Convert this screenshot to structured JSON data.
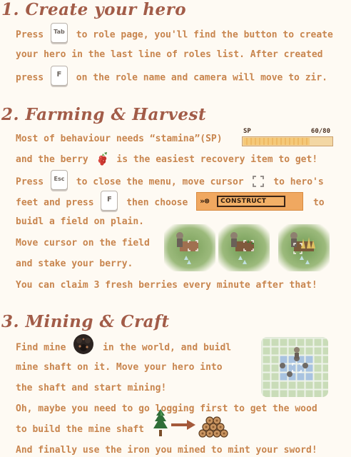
{
  "sections": [
    {
      "heading": "1. Create your hero",
      "lines": [
        {
          "a": "Press",
          "key": "Tab",
          "b": "to role page, you'll find the button to create"
        },
        {
          "a": "your hero in the last line of roles list.  After created"
        },
        {
          "a": "press",
          "key": "F",
          "b": "on the role name and camera will move to zir."
        }
      ]
    },
    {
      "heading": "2. Farming & Harvest",
      "lines": [
        {
          "a": "Most of behaviour needs “stamina”(SP)"
        },
        {
          "a": "and the berry",
          "b": "is the easiest recovery item to get!"
        },
        {
          "a": "Press",
          "key": "Esc",
          "b": "to close the menu, move cursor",
          "c": "to hero's"
        },
        {
          "a": "feet and press",
          "key": "F",
          "b": "then choose",
          "c": "to"
        },
        {
          "a": "buidl a field on plain."
        },
        {
          "a": "Move cursor on the field"
        },
        {
          "a": "and stake your berry."
        },
        {
          "a": "You can claim 3 fresh berries every minute after that!"
        }
      ]
    },
    {
      "heading": "3. Mining & Craft",
      "lines": [
        {
          "a": "Find mine",
          "b": "in the world, and buidl"
        },
        {
          "a": "mine shaft on it. Move your hero into"
        },
        {
          "a": "the shaft and start mining!"
        },
        {
          "a": "Oh, maybe you need to go logging first to get the wood"
        },
        {
          "a": "to build the mine shaft"
        },
        {
          "a": "And finally use the iron you mined to mint your sword!"
        }
      ]
    }
  ],
  "sp_bar": {
    "label": "SP",
    "value": "60/80",
    "fraction": 0.75
  },
  "construct_button": {
    "label": "CONSTRUCT"
  },
  "icons": {
    "berry": "berry-icon",
    "cursor": "cursor-bracket-icon",
    "mine": "mine-icon",
    "tree": "tree-icon",
    "arrow": "arrow-right-icon",
    "logs": "log-pile-icon"
  },
  "colors": {
    "heading": "#a25c48",
    "text": "#c8854e",
    "background": "#fefaf3"
  }
}
